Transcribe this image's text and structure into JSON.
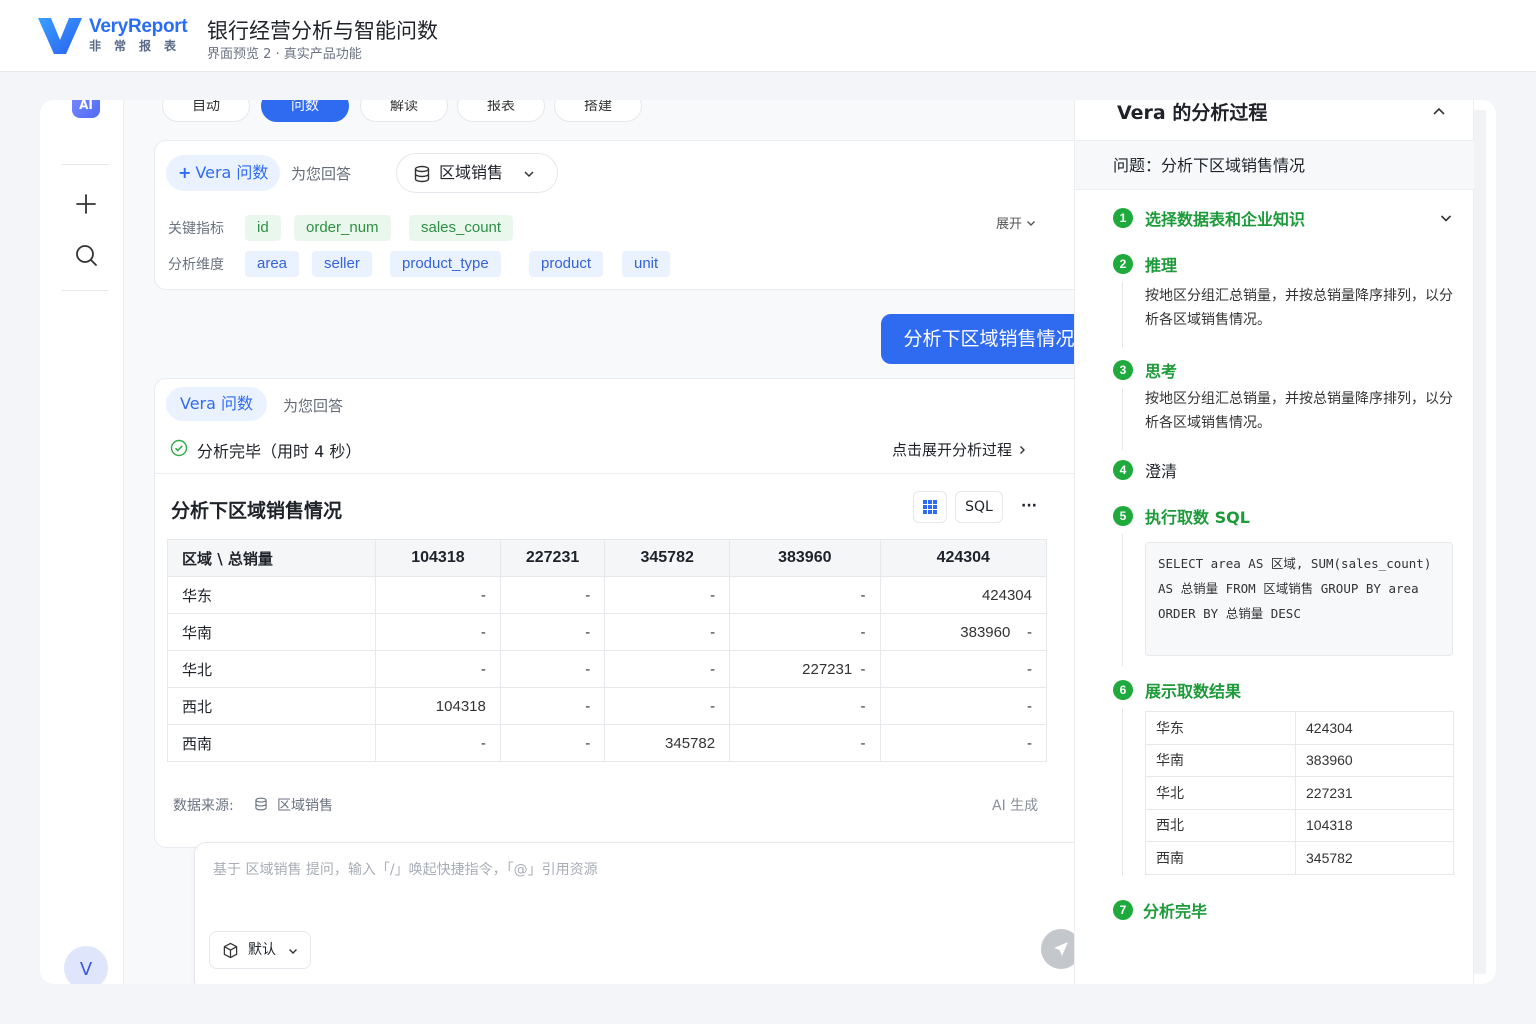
{
  "header": {
    "logo_en": "VeryReport",
    "logo_cn": "非常报表",
    "title": "银行经营分析与智能问数",
    "subtitle": "界面预览 2 · 真实产品功能"
  },
  "rail": {
    "ai_badge": "AI",
    "avatar": "V"
  },
  "tabs": [
    "自动",
    "问数",
    "解读",
    "报表",
    "搭建"
  ],
  "query_card": {
    "vera_label": "Vera 问数",
    "answer_for": "为您回答",
    "dataset": "区域销售",
    "metrics_label": "关键指标",
    "metrics": [
      "id",
      "order_num",
      "sales_count"
    ],
    "dims_label": "分析维度",
    "dims": [
      "area",
      "seller",
      "product_type",
      "product",
      "unit"
    ],
    "expand": "展开"
  },
  "user_bubble": "分析下区域销售情况",
  "answer_card": {
    "vera_label": "Vera 问数",
    "answer_for": "为您回答",
    "status": "分析完毕（用时 4 秒）",
    "expand_process": "点击展开分析过程",
    "title": "分析下区域销售情况",
    "sql_btn": "SQL",
    "more": "···",
    "table": {
      "corner": "区域 \\ 总销量",
      "columns": [
        "104318",
        "227231",
        "345782",
        "383960",
        "424304"
      ],
      "rows": [
        {
          "label": "华东",
          "cells": [
            "-",
            "-",
            "-",
            "-",
            "424304"
          ]
        },
        {
          "label": "华南",
          "cells": [
            "-",
            "-",
            "-",
            "-",
            "383960    -"
          ]
        },
        {
          "label": "华北",
          "cells": [
            "-",
            "-",
            "-",
            "227231  -",
            "-"
          ]
        },
        {
          "label": "西北",
          "cells": [
            "104318",
            "-",
            "-",
            "-",
            "-"
          ]
        },
        {
          "label": "西南",
          "cells": [
            "-",
            "-",
            "345782",
            "-",
            "-"
          ]
        }
      ]
    },
    "source_label": "数据来源:",
    "source_name": "区域销售",
    "ai_generated": "AI 生成"
  },
  "composer": {
    "placeholder": "基于 区域销售 提问，输入「/」唤起快捷指令，「@」引用资源",
    "model": "默认"
  },
  "process_panel": {
    "title": "Vera 的分析过程",
    "question": "问题：分析下区域销售情况",
    "steps": [
      {
        "num": "1",
        "label": "选择数据表和企业知识"
      },
      {
        "num": "2",
        "label": "推理",
        "text": "按地区分组汇总销量，并按总销量降序排列，以分析各区域销售情况。"
      },
      {
        "num": "3",
        "label": "思考",
        "text": "按地区分组汇总销量，并按总销量降序排列，以分析各区域销售情况。"
      },
      {
        "num": "4",
        "label": "澄清"
      },
      {
        "num": "5",
        "label": "执行取数 SQL",
        "sql": "SELECT area AS 区域, SUM(sales_count) AS 总销量 FROM 区域销售 GROUP BY area ORDER BY 总销量 DESC"
      },
      {
        "num": "6",
        "label": "展示取数结果"
      },
      {
        "num": "7",
        "label": "分析完毕"
      }
    ],
    "result_rows": [
      {
        "k": "华东",
        "v": "424304"
      },
      {
        "k": "华南",
        "v": "383960"
      },
      {
        "k": "华北",
        "v": "227231"
      },
      {
        "k": "西北",
        "v": "104318"
      },
      {
        "k": "西南",
        "v": "345782"
      }
    ]
  },
  "colors": {
    "primary": "#2f6bf0",
    "success": "#1faa3e"
  }
}
